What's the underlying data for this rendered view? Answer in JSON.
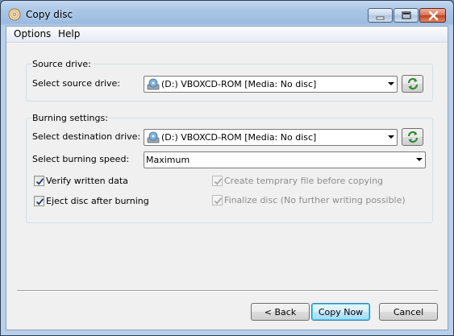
{
  "window": {
    "title": "Copy disc"
  },
  "menu": {
    "items": [
      "Options",
      "Help"
    ]
  },
  "source": {
    "group_label": "Source drive:",
    "select_label": "Select source drive:",
    "selected": "(D:) VBOXCD-ROM [Media: No disc]"
  },
  "burning": {
    "group_label": "Burning settings:",
    "dest_label": "Select destination drive:",
    "dest_selected": "(D:) VBOXCD-ROM [Media: No disc]",
    "speed_label": "Select burning speed:",
    "speed_selected": "Maximum",
    "verify": {
      "label": "Verify written data",
      "checked": true,
      "enabled": true
    },
    "eject": {
      "label": "Eject disc after burning",
      "checked": true,
      "enabled": true
    },
    "temp_file": {
      "label": "Create temprary file before copying",
      "checked": true,
      "enabled": false
    },
    "finalize": {
      "label": "Finalize disc (No further writing possible)",
      "checked": true,
      "enabled": false
    }
  },
  "buttons": {
    "back": "< Back",
    "copy": "Copy Now",
    "cancel": "Cancel"
  },
  "colors": {
    "title_bar": "#9bbbe0",
    "client_bg": "#f0f0f0",
    "close_button": "#c1401f",
    "default_button_border": "#3c7fb1"
  }
}
